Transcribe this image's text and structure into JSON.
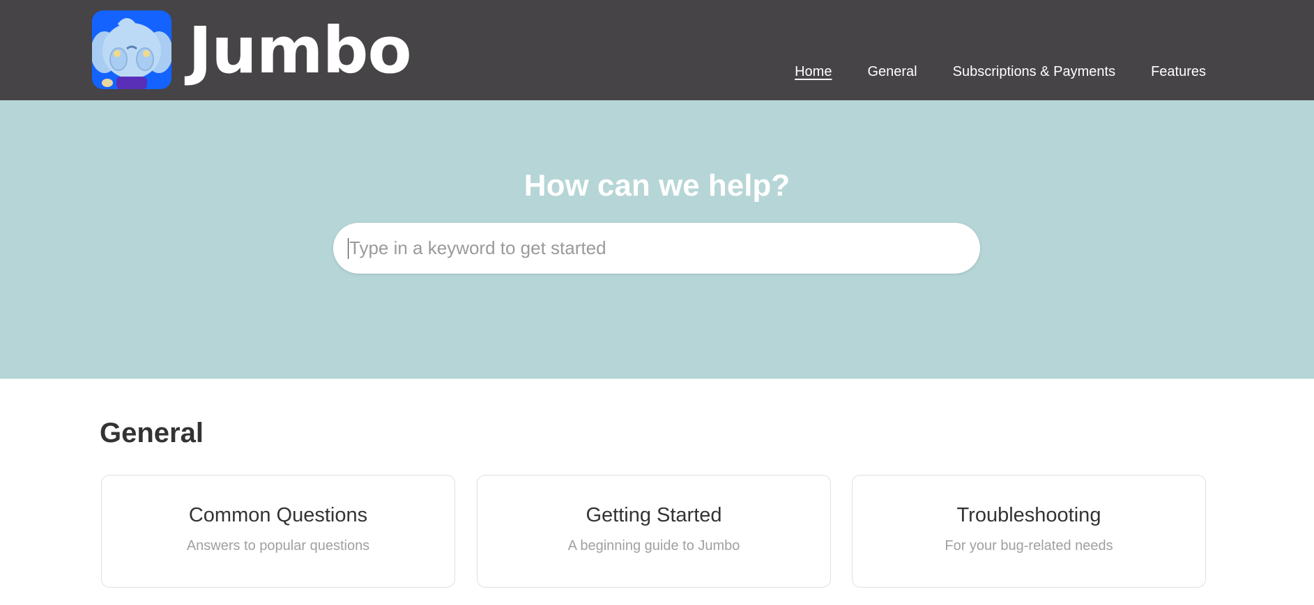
{
  "header": {
    "brand": "Jumbo",
    "nav": [
      {
        "label": "Home",
        "active": true
      },
      {
        "label": "General",
        "active": false
      },
      {
        "label": "Subscriptions & Payments",
        "active": false
      },
      {
        "label": "Features",
        "active": false
      }
    ]
  },
  "hero": {
    "title": "How can we help?",
    "search_placeholder": "Type in a keyword to get started"
  },
  "section": {
    "title": "General",
    "cards": [
      {
        "title": "Common Questions",
        "desc": "Answers to popular questions"
      },
      {
        "title": "Getting Started",
        "desc": "A beginning guide to Jumbo"
      },
      {
        "title": "Troubleshooting",
        "desc": "For your bug-related needs"
      }
    ]
  },
  "colors": {
    "header_bg": "#464447",
    "hero_bg": "#b6d5d6",
    "logo_bg": "#1463ff"
  }
}
